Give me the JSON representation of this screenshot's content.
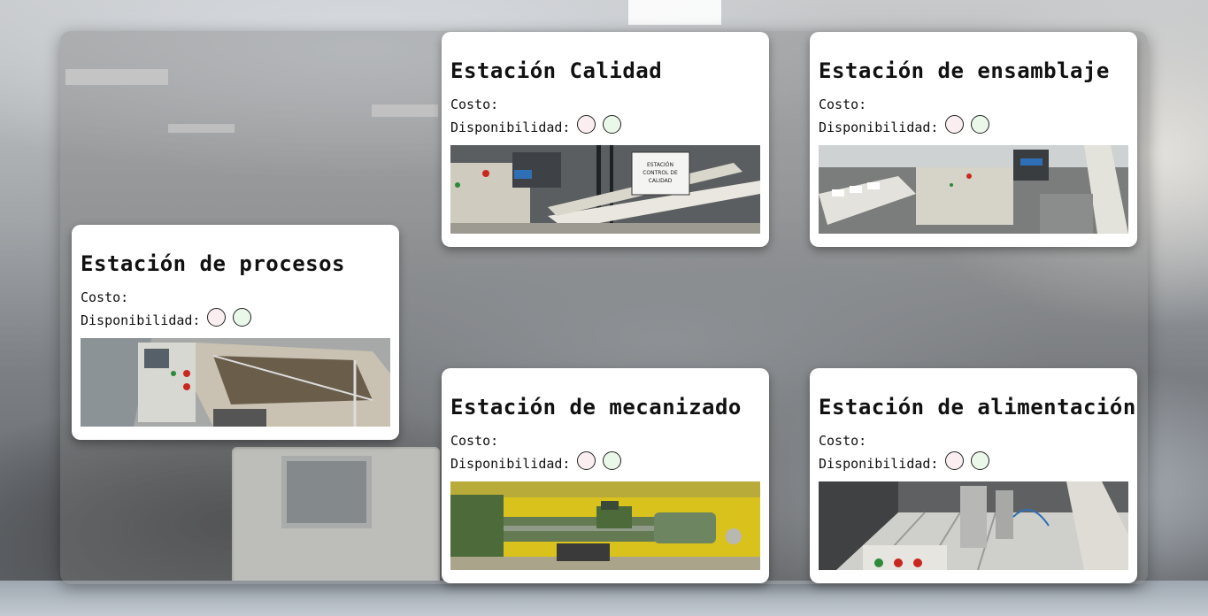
{
  "labels": {
    "cost": "Costo:",
    "availability": "Disponibilidad:"
  },
  "stations": [
    {
      "title": "Estación Calidad",
      "photo_icon": "quality-station-photo",
      "photo_sign": "ESTACIÓN CONTROL DE CALIDAD"
    },
    {
      "title": "Estación de ensamblaje",
      "photo_icon": "assembly-station-photo"
    },
    {
      "title": "Estación de procesos",
      "photo_icon": "process-station-photo"
    },
    {
      "title": "Estación de mecanizado",
      "photo_icon": "machining-station-photo"
    },
    {
      "title": "Estación de alimentación",
      "photo_icon": "feeding-station-photo"
    }
  ],
  "colors": {
    "status_red": "#fbeef1",
    "status_green": "#eaf8ea",
    "card_bg": "#ffffff"
  }
}
